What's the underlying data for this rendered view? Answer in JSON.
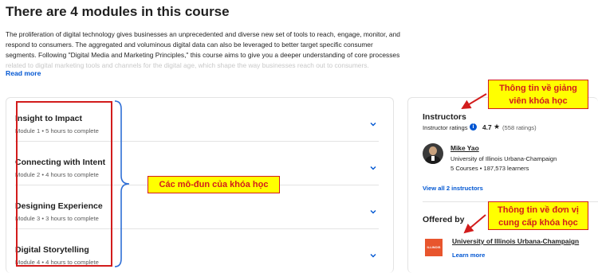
{
  "heading": "There are 4 modules in this course",
  "description": {
    "line1": "The proliferation of digital technology gives businesses an unprecedented and diverse new set of tools to reach, engage, monitor, and",
    "line2": "respond to consumers. The aggregated and voluminous digital data can also be leveraged to better target specific consumer",
    "line3": "segments. Following \"Digital Media and Marketing Principles,\" this course aims to give you a deeper understanding of core processes",
    "line4_faded": "related to digital marketing tools and channels for the digital age, which shape the way businesses reach out to consumers."
  },
  "read_more": "Read more",
  "modules": [
    {
      "title": "Insight to Impact",
      "meta": "Module 1  •  5 hours to complete"
    },
    {
      "title": "Connecting with Intent",
      "meta": "Module 2  •  4 hours to complete"
    },
    {
      "title": "Designing Experience",
      "meta": "Module 3  •  3 hours to complete"
    },
    {
      "title": "Digital Storytelling",
      "meta": "Module 4  •  4 hours to complete"
    }
  ],
  "instructors": {
    "title": "Instructors",
    "ratings_label": "Instructor ratings",
    "rating": "4.7",
    "star": "★",
    "rating_count": "(558 ratings)",
    "name": "Mike Yao",
    "org": "University of Illinois Urbana-Champaign",
    "stats": "5 Courses  •  187,573 learners",
    "view_all": "View all 2 instructors"
  },
  "offered_by": {
    "title": "Offered by",
    "logo_text": "ILLINOIS",
    "name": "University of Illinois Urbana-Champaign",
    "learn_more": "Learn more"
  },
  "annotations": {
    "modules_callout": "Các mô-đun của khóa học",
    "instructor_callout_l1": "Thông tin về giảng",
    "instructor_callout_l2": "viên khóa học",
    "offered_callout_l1": "Thông tin về đơn vị",
    "offered_callout_l2": "cung cấp khóa học",
    "annotation_color": "#d21c1c",
    "highlight_color": "#ffff00"
  },
  "colors": {
    "link": "#0056d2",
    "text": "#1f1f1f",
    "muted": "#5b5b5b",
    "border": "#e3e3e3"
  },
  "icons": {
    "chevron": "chevron-down-icon",
    "info": "info-icon",
    "star": "star-icon"
  }
}
